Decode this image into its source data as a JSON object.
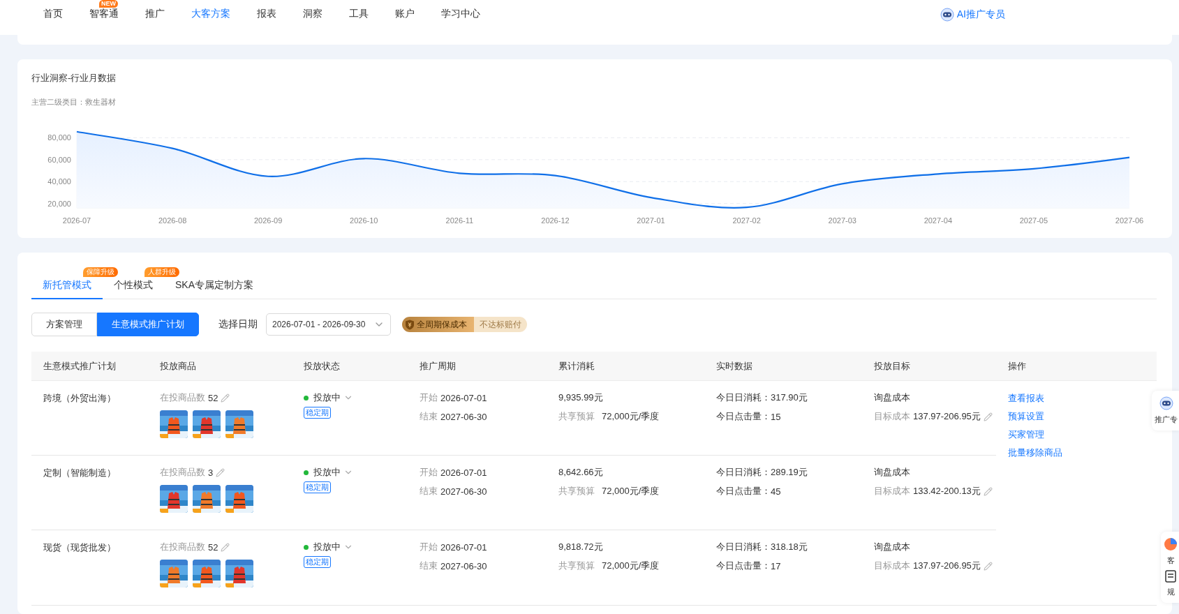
{
  "nav": {
    "items": [
      {
        "label": "首页",
        "selected": false
      },
      {
        "label": "智客通",
        "selected": false,
        "badge": "NEW"
      },
      {
        "label": "推广",
        "selected": false
      },
      {
        "label": "大客方案",
        "selected": true
      },
      {
        "label": "报表",
        "selected": false
      },
      {
        "label": "洞察",
        "selected": false
      },
      {
        "label": "工具",
        "selected": false
      },
      {
        "label": "账户",
        "selected": false
      },
      {
        "label": "学习中心",
        "selected": false
      }
    ],
    "assistant": "AI推广专员"
  },
  "chart_card": {
    "title": "行业洞察-行业月数据",
    "subtitle": "主营二级类目：救生器材",
    "chart_data": {
      "type": "area",
      "categories": [
        "2026-07",
        "2026-08",
        "2026-09",
        "2026-10",
        "2026-11",
        "2026-12",
        "2027-01",
        "2027-02",
        "2027-03",
        "2027-04",
        "2027-05",
        "2027-06"
      ],
      "series": [
        {
          "color": "#0f6fe8",
          "values": [
            85500,
            70300,
            44800,
            61000,
            47600,
            45500,
            25500,
            16500,
            38000,
            47000,
            51700,
            62000
          ]
        }
      ],
      "grid": true,
      "ylim": [
        16000,
        86000
      ],
      "yticks": [
        {
          "value": 20000,
          "label": "20,000"
        },
        {
          "value": 40000,
          "label": "40,000"
        },
        {
          "value": 60000,
          "label": "60,000"
        },
        {
          "value": 80000,
          "label": "80,000"
        }
      ]
    }
  },
  "plan_card": {
    "tabs": [
      {
        "label": "新托管模式",
        "selected": true,
        "badge": "保障升级"
      },
      {
        "label": "个性模式",
        "selected": false,
        "badge": "人群升级"
      },
      {
        "label": "SKA专属定制方案",
        "selected": false
      }
    ],
    "segments": [
      {
        "label": "方案管理",
        "selected": false
      },
      {
        "label": "生意模式推广计划",
        "selected": true
      }
    ],
    "date_label": "选择日期",
    "date_value": "2026-07-01 - 2026-09-30",
    "guarantee": {
      "main": "全周期保成本",
      "sub": "不达标赔付"
    },
    "table": {
      "columns": [
        "生意模式推广计划",
        "投放商品",
        "投放状态",
        "推广周期",
        "累计消耗",
        "实时数据",
        "投放目标",
        "操作"
      ],
      "rows": [
        {
          "name": "跨境（外贸出海）",
          "count_label": "在投商品数",
          "count": "52",
          "status": "投放中",
          "tag": "稳定期",
          "start_label": "开始",
          "start": "2026-07-01",
          "end_label": "结束",
          "end": "2027-06-30",
          "spend": "9,935.99元",
          "budget_label": "共享预算",
          "budget": "72,000元/季度",
          "today_spend_label": "今日日消耗：",
          "today_spend": "317.90元",
          "clicks_label": "今日点击量：",
          "clicks": "15",
          "goal": "询盘成本",
          "target_label": "目标成本",
          "target": "137.97-206.95元"
        },
        {
          "name": "定制（智能制造）",
          "count_label": "在投商品数",
          "count": "3",
          "status": "投放中",
          "tag": "稳定期",
          "start_label": "开始",
          "start": "2026-07-01",
          "end_label": "结束",
          "end": "2027-06-30",
          "spend": "8,642.66元",
          "budget_label": "共享预算",
          "budget": "72,000元/季度",
          "today_spend_label": "今日日消耗：",
          "today_spend": "289.19元",
          "clicks_label": "今日点击量：",
          "clicks": "45",
          "goal": "询盘成本",
          "target_label": "目标成本",
          "target": "133.42-200.13元"
        },
        {
          "name": "现货（现货批发）",
          "count_label": "在投商品数",
          "count": "52",
          "status": "投放中",
          "tag": "稳定期",
          "start_label": "开始",
          "start": "2026-07-01",
          "end_label": "结束",
          "end": "2027-06-30",
          "spend": "9,818.72元",
          "budget_label": "共享预算",
          "budget": "72,000元/季度",
          "today_spend_label": "今日日消耗：",
          "today_spend": "318.18元",
          "clicks_label": "今日点击量：",
          "clicks": "17",
          "goal": "询盘成本",
          "target_label": "目标成本",
          "target": "137.97-206.95元"
        }
      ],
      "actions": [
        "查看报表",
        "预算设置",
        "买家管理",
        "批量移除商品"
      ]
    }
  },
  "side_widgets": [
    {
      "label": "推广专"
    },
    {
      "label": "客"
    },
    {
      "label": "规"
    }
  ]
}
